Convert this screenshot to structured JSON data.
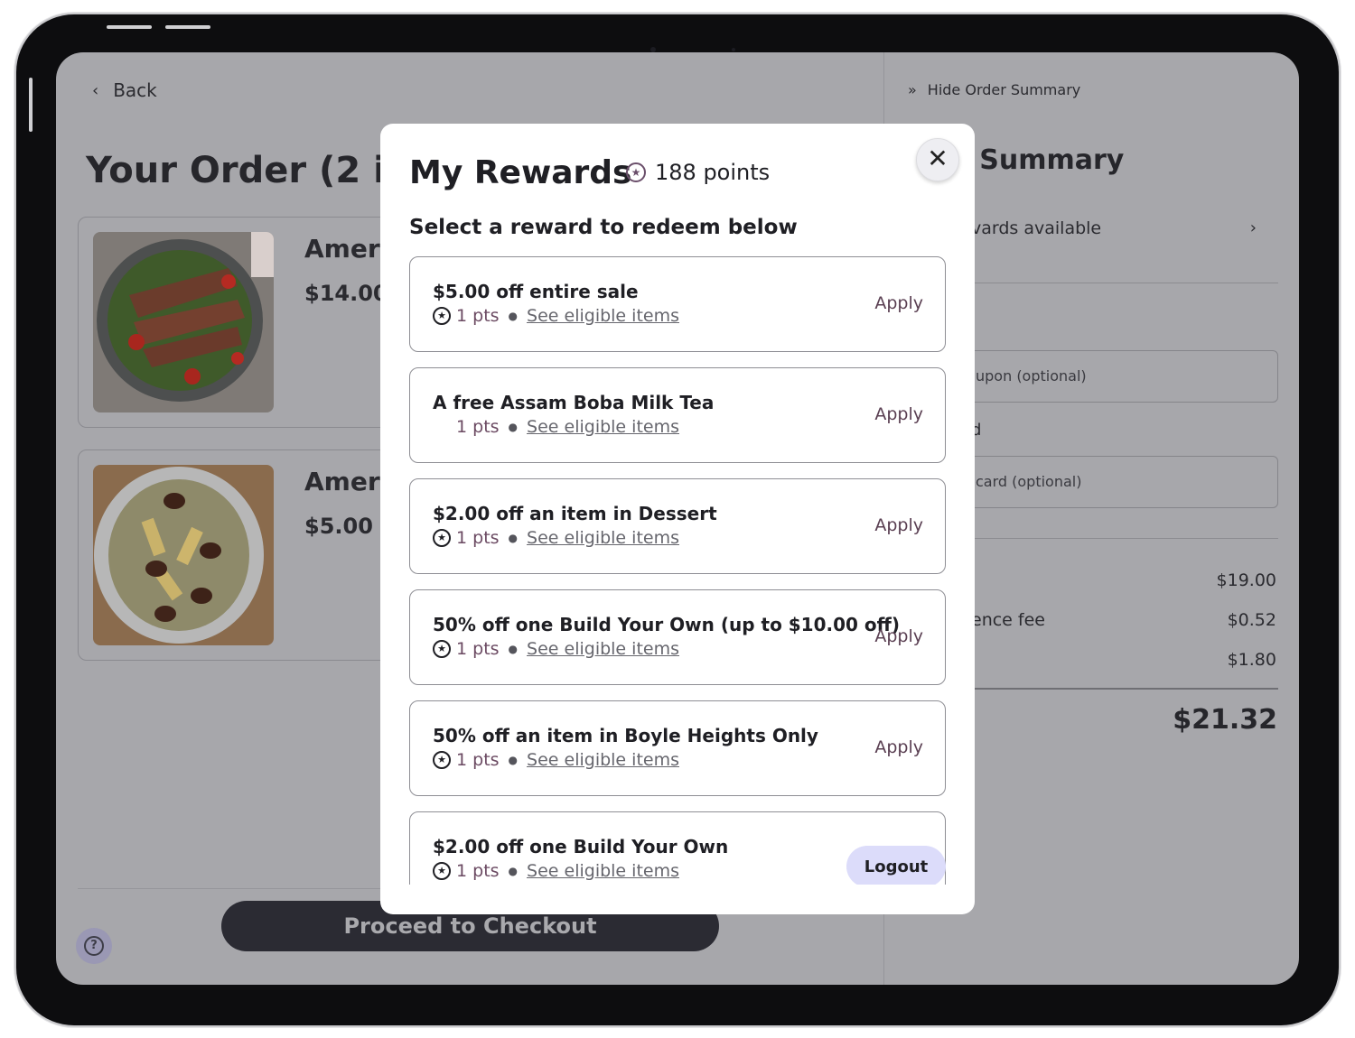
{
  "nav": {
    "back_label": "Back"
  },
  "order": {
    "title": "Your Order (2 ite",
    "items": [
      {
        "name": "Ameri",
        "price": "$14.00"
      },
      {
        "name": "Ameri",
        "price": "$5.00"
      }
    ],
    "checkout_label": "Proceed to Checkout",
    "help_icon": "question-circle-icon"
  },
  "summary": {
    "hide_label": "Hide Order Summary",
    "title": "r Summary",
    "rewards_available": "vards available",
    "coupon_placeholder": "upon (optional)",
    "gift_label": "d",
    "gift_placeholder": "card (optional)",
    "lines": [
      {
        "label": "l",
        "value": "$19.00"
      },
      {
        "label": "ence fee",
        "value": "$0.52"
      },
      {
        "label": "",
        "value": "$1.80"
      }
    ],
    "total": "$21.32"
  },
  "modal": {
    "title": "My Rewards",
    "points": "188 points",
    "close_icon": "close-icon",
    "subtitle": "Select a reward to redeem below",
    "apply_label": "Apply",
    "eligible_label": "See eligible items",
    "rewards": [
      {
        "name": "$5.00 off entire sale",
        "pts": "1 pts",
        "show_star": true
      },
      {
        "name": "A free Assam Boba Milk Tea",
        "pts": "1 pts",
        "show_star": false
      },
      {
        "name": "$2.00 off an item in Dessert",
        "pts": "1 pts",
        "show_star": true
      },
      {
        "name": "50% off one Build Your Own (up to $10.00 off)",
        "pts": "1 pts",
        "show_star": true
      },
      {
        "name": "50% off an item in Boyle Heights Only",
        "pts": "1 pts",
        "show_star": true
      },
      {
        "name": "$2.00 off one Build Your Own",
        "pts": "1 pts",
        "show_star": true
      }
    ],
    "logout_label": "Logout"
  },
  "colors": {
    "overlay": "#a7a7ab",
    "accent_purple": "#6a4e6a",
    "logout_bg": "#dcdcfa",
    "checkout_bg": "#2b2b33"
  }
}
